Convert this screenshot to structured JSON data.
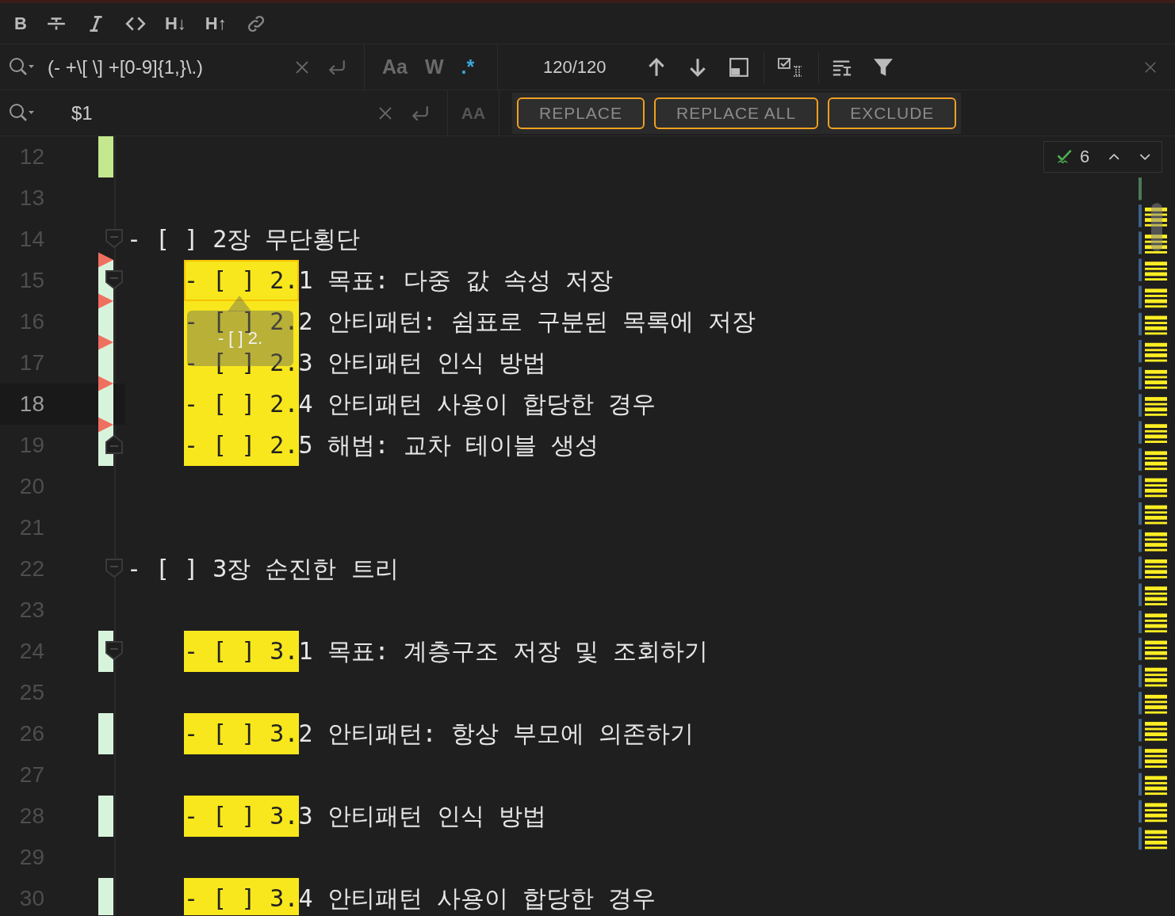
{
  "toolbar": [
    {
      "kind": "text",
      "label": "B"
    },
    {
      "kind": "strike"
    },
    {
      "kind": "italic"
    },
    {
      "kind": "code"
    },
    {
      "kind": "text",
      "label": "H↓"
    },
    {
      "kind": "text",
      "label": "H↑"
    },
    {
      "kind": "link"
    }
  ],
  "find": {
    "value": "(- +\\[ \\] +[0-9]{1,}\\.)",
    "options": [
      {
        "label": "Aa",
        "selected": false
      },
      {
        "label": "W",
        "selected": false
      },
      {
        "label": ".*",
        "selected": true
      }
    ],
    "count": "120/120"
  },
  "replace": {
    "value": "$1",
    "case_label": "AA",
    "buttons": [
      "REPLACE",
      "REPLACE ALL",
      "EXCLUDE"
    ]
  },
  "inspection": {
    "count": "6"
  },
  "tooltip": "- [ ] 2.",
  "lines": [
    {
      "number": "12",
      "kind": "blank",
      "color": "#c3e88d",
      "current": false
    },
    {
      "number": "13",
      "kind": "blank",
      "current": false
    },
    {
      "number": "14",
      "kind": "heading",
      "text": "- [ ] 2장 무단횡단",
      "fold_start": true,
      "deleted_below": true,
      "current": false
    },
    {
      "number": "15",
      "kind": "item",
      "match": "- [ ] 2.",
      "text": "1 목표: 다중 값 속성 저장",
      "active_match": true,
      "fold_start": true,
      "color": "#d8f3dc",
      "deleted_below": true,
      "current": false
    },
    {
      "number": "16",
      "kind": "item",
      "match": "- [ ] 2.",
      "text": "2 안티패턴: 쉼표로 구분된 목록에 저장",
      "active_match": false,
      "color": "#d8f3dc",
      "deleted_below": true,
      "current": false
    },
    {
      "number": "17",
      "kind": "item",
      "match": "- [ ] 2.",
      "text": "3 안티패턴 인식 방법",
      "active_match": false,
      "color": "#d8f3dc",
      "deleted_below": true,
      "current": false
    },
    {
      "number": "18",
      "kind": "item",
      "match": "- [ ] 2.",
      "text": "4 안티패턴 사용이 합당한 경우",
      "active_match": false,
      "color": "#d8f3dc",
      "deleted_below": true,
      "current": true
    },
    {
      "number": "19",
      "kind": "item",
      "match": "- [ ] 2.",
      "text": "5 해법: 교차 테이블 생성",
      "active_match": false,
      "fold_end": true,
      "color": "#d8f3dc",
      "current": false
    },
    {
      "number": "20",
      "kind": "blank",
      "current": false
    },
    {
      "number": "21",
      "kind": "blank",
      "current": false
    },
    {
      "number": "22",
      "kind": "heading",
      "text": "- [ ] 3장 순진한 트리",
      "fold_start": true,
      "current": false
    },
    {
      "number": "23",
      "kind": "blank",
      "current": false
    },
    {
      "number": "24",
      "kind": "item",
      "match": "- [ ] 3.",
      "text": "1 목표: 계층구조 저장 및 조회하기",
      "active_match": false,
      "fold_start": true,
      "color": "#d8f3dc",
      "current": false
    },
    {
      "number": "25",
      "kind": "blank",
      "current": false
    },
    {
      "number": "26",
      "kind": "item",
      "match": "- [ ] 3.",
      "text": "2 안티패턴: 항상 부모에 의존하기",
      "active_match": false,
      "color": "#d8f3dc",
      "current": false
    },
    {
      "number": "27",
      "kind": "blank",
      "current": false
    },
    {
      "number": "28",
      "kind": "item",
      "match": "- [ ] 3.",
      "text": "3 안티패턴 인식 방법",
      "active_match": false,
      "color": "#d8f3dc",
      "current": false
    },
    {
      "number": "29",
      "kind": "blank",
      "current": false
    },
    {
      "number": "30",
      "kind": "item",
      "match": "- [ ] 3.",
      "text": "4 안티패턴 사용이 합당한 경우",
      "active_match": false,
      "color": "#d8f3dc",
      "current": false
    }
  ]
}
